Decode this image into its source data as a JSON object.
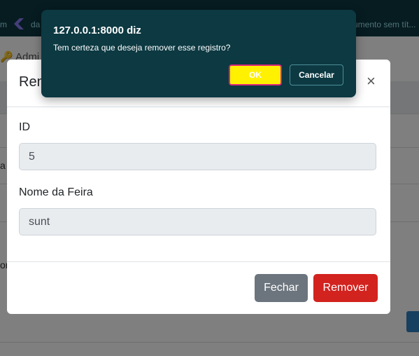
{
  "background": {
    "topbar_left_fragment": "m",
    "topbar_left_text": "da",
    "topbar_right_fragment": "umento sem tít...",
    "admin_fragment": "Admi",
    "row_fragment_1": "a",
    "row_fragment_2": "or"
  },
  "modal": {
    "title": "Rem",
    "close_symbol": "×",
    "fields": [
      {
        "label": "ID",
        "value": "5"
      },
      {
        "label": "Nome da Feira",
        "value": "sunt"
      }
    ],
    "buttons": {
      "close": "Fechar",
      "remove": "Remover"
    }
  },
  "confirm": {
    "title": "127.0.0.1:8000 diz",
    "message": "Tem certeza que deseja remover esse registro?",
    "ok": "OK",
    "cancel": "Cancelar"
  },
  "colors": {
    "dialog_bg": "#0c3942",
    "ok_bg": "#fff100",
    "ok_border": "#d9277a",
    "remove": "#d2231f",
    "close": "#6c757d"
  }
}
